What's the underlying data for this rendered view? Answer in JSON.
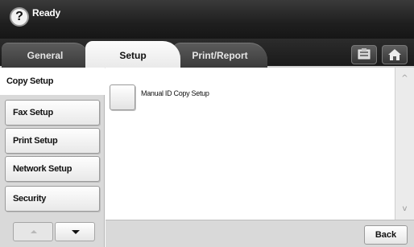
{
  "status": {
    "help_glyph": "?",
    "text": "Ready"
  },
  "tabs": [
    {
      "label": "General",
      "active": false
    },
    {
      "label": "Setup",
      "active": true
    },
    {
      "label": "Print/Report",
      "active": false
    }
  ],
  "top_buttons": {
    "job_status_icon": "job-status-icon",
    "home_icon": "home-icon"
  },
  "sidebar": {
    "items": [
      {
        "label": "Copy Setup",
        "selected": true
      },
      {
        "label": "Fax Setup",
        "selected": false
      },
      {
        "label": "Print Setup",
        "selected": false
      },
      {
        "label": "Network Setup",
        "selected": false
      },
      {
        "label": "Security",
        "selected": false
      }
    ],
    "scroll_up_enabled": false,
    "scroll_down_enabled": true
  },
  "content": {
    "options": [
      {
        "label": "Manual ID Copy Setup"
      }
    ]
  },
  "scrollbar": {
    "up_glyph": "^",
    "down_glyph": "v"
  },
  "footer": {
    "back_label": "Back"
  },
  "colors": {
    "topbar": "#1f1f1f",
    "active_tab": "#f4f4f4",
    "inactive_tab": "#4a4a4a",
    "panel_bg": "#d9d9d9"
  }
}
